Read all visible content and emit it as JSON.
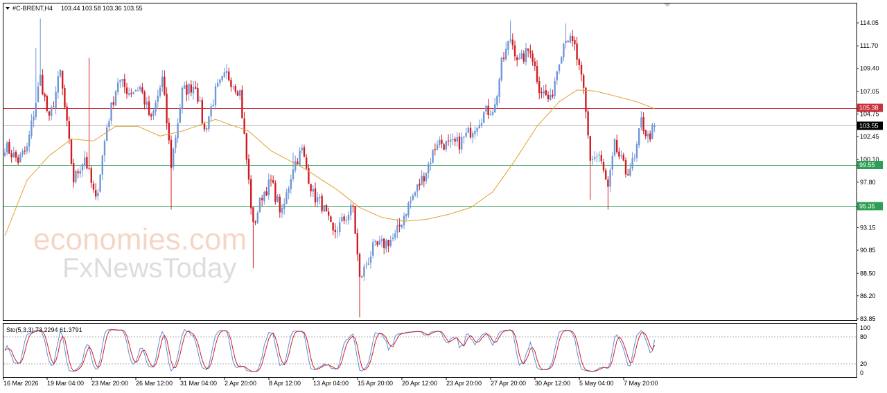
{
  "header": {
    "symbol_label": "#C-BRENT,H4",
    "ohlc": "103.44 103.58 103.36 103.55"
  },
  "stoch_header": "Sto(5,3,3) 73.2294 61.3791",
  "watermark": {
    "brand1": "economies.com",
    "brand2": "FxNewsToday"
  },
  "colors": {
    "bull": "#6e97d8",
    "bear": "#d01c23",
    "ma": "#e0a030",
    "resistance": "#c8323c",
    "support": "#2e9e55",
    "price_line": "#b4b4b4",
    "stoch_main": "#5a8fd8",
    "stoch_signal": "#d01c23"
  },
  "chart_data": [
    {
      "type": "candlestick",
      "symbol": "#C-BRENT",
      "timeframe": "H4",
      "ylim": [
        83.85,
        115.2
      ],
      "y_ticks": [
        "114.05",
        "111.70",
        "109.40",
        "107.05",
        "104.75",
        "102.45",
        "100.10",
        "97.80",
        "95.50",
        "93.15",
        "90.85",
        "88.50",
        "86.20",
        "83.85"
      ],
      "x_labels": [
        "16 Mar 2026",
        "19 Mar 04:00",
        "23 Mar 20:00",
        "26 Mar 12:00",
        "31 Mar 04:00",
        "2 Apr 20:00",
        "8 Apr 12:00",
        "13 Apr 04:00",
        "15 Apr 20:00",
        "20 Apr 12:00",
        "23 Apr 20:00",
        "27 Apr 20:00",
        "30 Apr 12:00",
        "5 May 04:00",
        "7 May 20:00"
      ],
      "levels": [
        {
          "label": "105.38",
          "value": 105.38,
          "kind": "resistance"
        },
        {
          "label": "103.55",
          "value": 103.55,
          "kind": "price"
        },
        {
          "label": "99.55",
          "value": 99.55,
          "kind": "support"
        },
        {
          "label": "95.35",
          "value": 95.35,
          "kind": "support"
        }
      ],
      "price_anchors": [
        [
          0,
          101.5
        ],
        [
          6,
          100.0
        ],
        [
          10,
          101.2
        ],
        [
          16,
          108.5
        ],
        [
          20,
          104.0
        ],
        [
          25,
          109.0
        ],
        [
          31,
          98.0
        ],
        [
          36,
          100.4
        ],
        [
          41,
          95.8
        ],
        [
          46,
          103.5
        ],
        [
          51,
          108.2
        ],
        [
          56,
          107.0
        ],
        [
          61,
          107.5
        ],
        [
          66,
          104.0
        ],
        [
          71,
          108.3
        ],
        [
          75,
          99.6
        ],
        [
          80,
          107.0
        ],
        [
          86,
          107.8
        ],
        [
          90,
          103.0
        ],
        [
          95,
          107.0
        ],
        [
          100,
          108.8
        ],
        [
          106,
          107.0
        ],
        [
          112,
          93.2
        ],
        [
          116,
          96.5
        ],
        [
          120,
          97.8
        ],
        [
          125,
          94.5
        ],
        [
          130,
          99.5
        ],
        [
          134,
          101.0
        ],
        [
          139,
          96.5
        ],
        [
          143,
          95.5
        ],
        [
          148,
          92.5
        ],
        [
          153,
          94.0
        ],
        [
          157,
          95.2
        ],
        [
          160,
          87.8
        ],
        [
          166,
          91.0
        ],
        [
          171,
          91.5
        ],
        [
          176,
          92.2
        ],
        [
          181,
          95.0
        ],
        [
          186,
          97.2
        ],
        [
          190,
          99.0
        ],
        [
          195,
          102.0
        ],
        [
          200,
          101.5
        ],
        [
          205,
          101.8
        ],
        [
          210,
          103.0
        ],
        [
          216,
          104.8
        ],
        [
          221,
          105.5
        ],
        [
          224,
          109.8
        ],
        [
          228,
          112.5
        ],
        [
          232,
          110.0
        ],
        [
          237,
          111.5
        ],
        [
          241,
          107.5
        ],
        [
          246,
          106.0
        ],
        [
          250,
          110.5
        ],
        [
          253,
          112.8
        ],
        [
          257,
          111.5
        ],
        [
          261,
          107.0
        ],
        [
          264,
          100.2
        ],
        [
          268,
          100.5
        ],
        [
          272,
          97.0
        ],
        [
          275,
          101.5
        ],
        [
          280,
          98.8
        ],
        [
          284,
          100.0
        ],
        [
          287,
          104.0
        ],
        [
          290,
          102.3
        ],
        [
          293,
          103.5
        ]
      ],
      "ma_anchors": [
        [
          0,
          92.3
        ],
        [
          10,
          98.0
        ],
        [
          20,
          100.5
        ],
        [
          30,
          102.2
        ],
        [
          40,
          102.0
        ],
        [
          50,
          103.5
        ],
        [
          60,
          103.5
        ],
        [
          70,
          102.5
        ],
        [
          80,
          103.0
        ],
        [
          95,
          104.2
        ],
        [
          110,
          103.0
        ],
        [
          120,
          101.0
        ],
        [
          135,
          99.2
        ],
        [
          150,
          97.0
        ],
        [
          160,
          95.2
        ],
        [
          170,
          94.2
        ],
        [
          180,
          93.8
        ],
        [
          190,
          94.0
        ],
        [
          200,
          94.5
        ],
        [
          210,
          95.2
        ],
        [
          220,
          96.8
        ],
        [
          230,
          100.0
        ],
        [
          240,
          103.5
        ],
        [
          250,
          106.0
        ],
        [
          258,
          107.2
        ],
        [
          266,
          107.1
        ],
        [
          275,
          106.6
        ],
        [
          285,
          106.0
        ],
        [
          293,
          105.3
        ]
      ]
    },
    {
      "type": "line",
      "indicator": "Stochastic",
      "ylim": [
        0,
        100
      ],
      "y_ticks": [
        "100",
        "80",
        "20",
        "0"
      ],
      "levels": [
        80,
        20
      ],
      "values": {
        "k": 73.2294,
        "d": 61.3791
      }
    }
  ]
}
